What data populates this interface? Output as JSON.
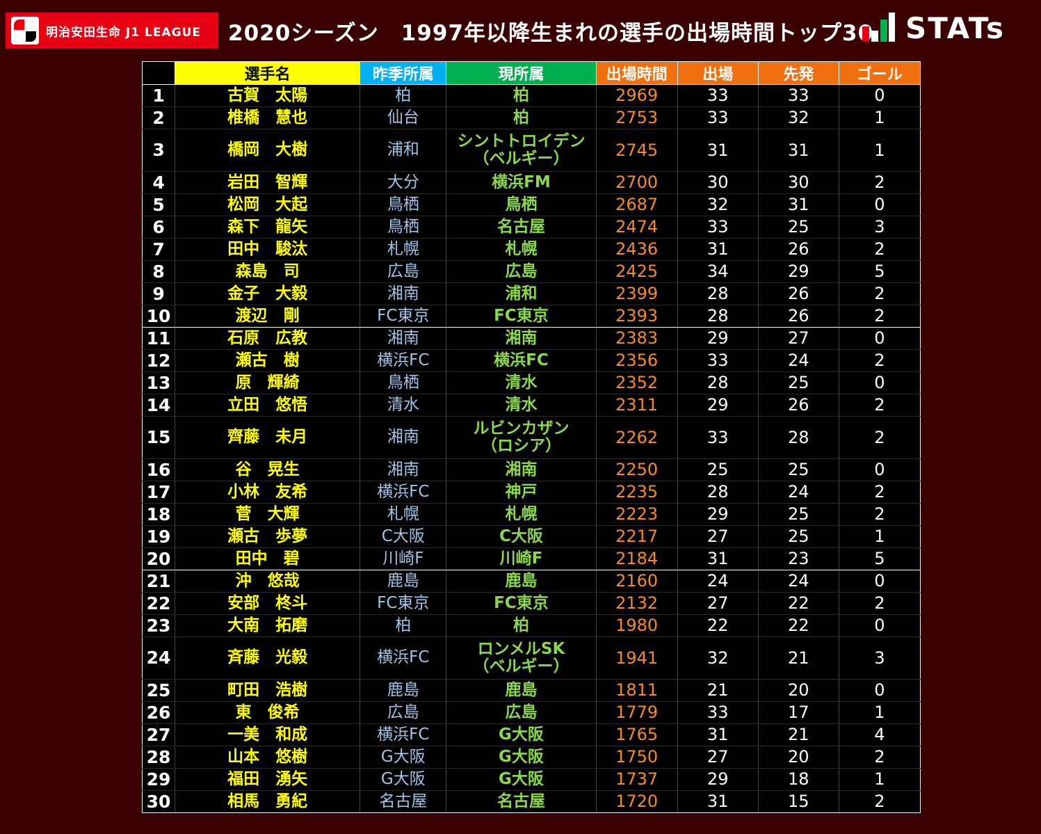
{
  "header": {
    "logo_text": "明治安田生命 J1 LEAGUE",
    "title": "2020シーズン　1997年以降生まれの選手の出場時間トップ30",
    "brand": "STATs",
    "colors": {
      "background": "#3a0000",
      "logo_red": "#e60012"
    }
  },
  "chart_data": {
    "type": "table",
    "title": "2020シーズン　1997年以降生まれの選手の出場時間トップ30",
    "columns": [
      "",
      "選手名",
      "昨季所属",
      "現所属",
      "出場時間",
      "出場",
      "先発",
      "ゴール"
    ],
    "column_colors": [
      "#000000",
      "#ffff00",
      "#00b0f0",
      "#00b050",
      "#f07010",
      "#f07010",
      "#f07010",
      "#f07010"
    ],
    "rows": [
      {
        "rank": "1",
        "name": "古賀　太陽",
        "prev": "柏",
        "cur": "柏",
        "minutes": "2969",
        "apps": "33",
        "starts": "33",
        "goals": "0"
      },
      {
        "rank": "2",
        "name": "椎橋　慧也",
        "prev": "仙台",
        "cur": "柏",
        "minutes": "2753",
        "apps": "33",
        "starts": "32",
        "goals": "1"
      },
      {
        "rank": "3",
        "name": "橋岡　大樹",
        "prev": "浦和",
        "cur": "シントトロイデン\n（ベルギー）",
        "minutes": "2745",
        "apps": "31",
        "starts": "31",
        "goals": "1"
      },
      {
        "rank": "4",
        "name": "岩田　智輝",
        "prev": "大分",
        "cur": "横浜FM",
        "minutes": "2700",
        "apps": "30",
        "starts": "30",
        "goals": "2"
      },
      {
        "rank": "5",
        "name": "松岡　大起",
        "prev": "鳥栖",
        "cur": "鳥栖",
        "minutes": "2687",
        "apps": "32",
        "starts": "31",
        "goals": "0"
      },
      {
        "rank": "6",
        "name": "森下　龍矢",
        "prev": "鳥栖",
        "cur": "名古屋",
        "minutes": "2474",
        "apps": "33",
        "starts": "25",
        "goals": "3"
      },
      {
        "rank": "7",
        "name": "田中　駿汰",
        "prev": "札幌",
        "cur": "札幌",
        "minutes": "2436",
        "apps": "31",
        "starts": "26",
        "goals": "2"
      },
      {
        "rank": "8",
        "name": "森島　司",
        "prev": "広島",
        "cur": "広島",
        "minutes": "2425",
        "apps": "34",
        "starts": "29",
        "goals": "5"
      },
      {
        "rank": "9",
        "name": "金子　大毅",
        "prev": "湘南",
        "cur": "浦和",
        "minutes": "2399",
        "apps": "28",
        "starts": "26",
        "goals": "2"
      },
      {
        "rank": "10",
        "name": "渡辺　剛",
        "prev": "FC東京",
        "cur": "FC東京",
        "minutes": "2393",
        "apps": "28",
        "starts": "26",
        "goals": "2"
      },
      {
        "rank": "11",
        "name": "石原　広教",
        "prev": "湘南",
        "cur": "湘南",
        "minutes": "2383",
        "apps": "29",
        "starts": "27",
        "goals": "0"
      },
      {
        "rank": "12",
        "name": "瀬古　樹",
        "prev": "横浜FC",
        "cur": "横浜FC",
        "minutes": "2356",
        "apps": "33",
        "starts": "24",
        "goals": "2"
      },
      {
        "rank": "13",
        "name": "原　輝綺",
        "prev": "鳥栖",
        "cur": "清水",
        "minutes": "2352",
        "apps": "28",
        "starts": "25",
        "goals": "0"
      },
      {
        "rank": "14",
        "name": "立田　悠悟",
        "prev": "清水",
        "cur": "清水",
        "minutes": "2311",
        "apps": "29",
        "starts": "26",
        "goals": "2"
      },
      {
        "rank": "15",
        "name": "齊藤　未月",
        "prev": "湘南",
        "cur": "ルビンカザン\n（ロシア）",
        "minutes": "2262",
        "apps": "33",
        "starts": "28",
        "goals": "2"
      },
      {
        "rank": "16",
        "name": "谷　晃生",
        "prev": "湘南",
        "cur": "湘南",
        "minutes": "2250",
        "apps": "25",
        "starts": "25",
        "goals": "0"
      },
      {
        "rank": "17",
        "name": "小林　友希",
        "prev": "横浜FC",
        "cur": "神戸",
        "minutes": "2235",
        "apps": "28",
        "starts": "24",
        "goals": "2"
      },
      {
        "rank": "18",
        "name": "菅　大輝",
        "prev": "札幌",
        "cur": "札幌",
        "minutes": "2223",
        "apps": "29",
        "starts": "25",
        "goals": "2"
      },
      {
        "rank": "19",
        "name": "瀬古　歩夢",
        "prev": "C大阪",
        "cur": "C大阪",
        "minutes": "2217",
        "apps": "27",
        "starts": "25",
        "goals": "1"
      },
      {
        "rank": "20",
        "name": "田中　碧",
        "prev": "川崎F",
        "cur": "川崎F",
        "minutes": "2184",
        "apps": "31",
        "starts": "23",
        "goals": "5"
      },
      {
        "rank": "21",
        "name": "沖　悠哉",
        "prev": "鹿島",
        "cur": "鹿島",
        "minutes": "2160",
        "apps": "24",
        "starts": "24",
        "goals": "0"
      },
      {
        "rank": "22",
        "name": "安部　柊斗",
        "prev": "FC東京",
        "cur": "FC東京",
        "minutes": "2132",
        "apps": "27",
        "starts": "22",
        "goals": "2"
      },
      {
        "rank": "23",
        "name": "大南　拓磨",
        "prev": "柏",
        "cur": "柏",
        "minutes": "1980",
        "apps": "22",
        "starts": "22",
        "goals": "0"
      },
      {
        "rank": "24",
        "name": "斉藤　光毅",
        "prev": "横浜FC",
        "cur": "ロンメルSK\n（ベルギー）",
        "minutes": "1941",
        "apps": "32",
        "starts": "21",
        "goals": "3"
      },
      {
        "rank": "25",
        "name": "町田　浩樹",
        "prev": "鹿島",
        "cur": "鹿島",
        "minutes": "1811",
        "apps": "21",
        "starts": "20",
        "goals": "0"
      },
      {
        "rank": "26",
        "name": "東　俊希",
        "prev": "広島",
        "cur": "広島",
        "minutes": "1779",
        "apps": "33",
        "starts": "17",
        "goals": "1"
      },
      {
        "rank": "27",
        "name": "一美　和成",
        "prev": "横浜FC",
        "cur": "G大阪",
        "minutes": "1765",
        "apps": "31",
        "starts": "21",
        "goals": "4"
      },
      {
        "rank": "28",
        "name": "山本　悠樹",
        "prev": "G大阪",
        "cur": "G大阪",
        "minutes": "1750",
        "apps": "27",
        "starts": "20",
        "goals": "2"
      },
      {
        "rank": "29",
        "name": "福田　湧矢",
        "prev": "G大阪",
        "cur": "G大阪",
        "minutes": "1737",
        "apps": "29",
        "starts": "18",
        "goals": "1"
      },
      {
        "rank": "30",
        "name": "相馬　勇紀",
        "prev": "名古屋",
        "cur": "名古屋",
        "minutes": "1720",
        "apps": "31",
        "starts": "15",
        "goals": "2"
      }
    ]
  }
}
